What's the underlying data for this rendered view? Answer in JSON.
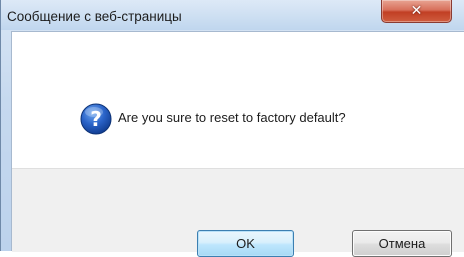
{
  "dialog": {
    "title": "Сообщение с веб-страницы",
    "close_symbol": "✕",
    "icon": "question-icon",
    "message": "Are you sure to reset to factory default?",
    "ok_label": "OK",
    "cancel_label": "Отмена"
  },
  "colors": {
    "title_bar": "#cddff2",
    "close_button": "#c13f24",
    "ok_border": "#3c7fb1",
    "button_bar": "#f0f0f0"
  }
}
